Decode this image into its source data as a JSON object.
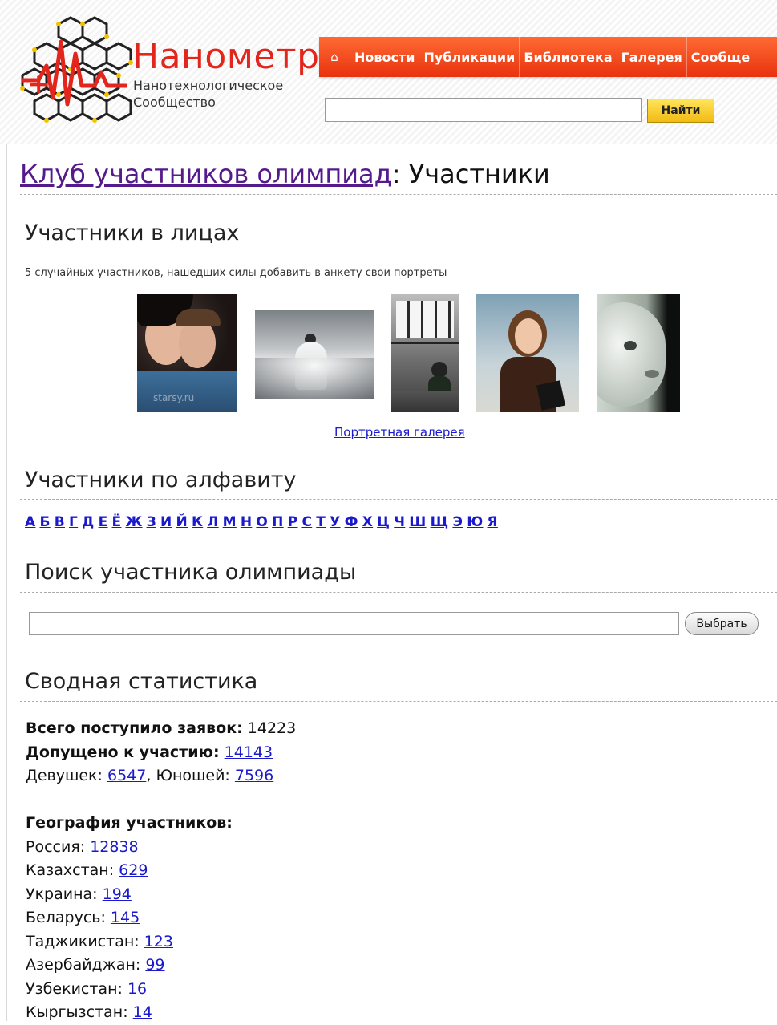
{
  "header": {
    "brand": "Нанометр",
    "tagline_line1": "Нанотехнологическое",
    "tagline_line2": "Сообщество",
    "nav": [
      "Новости",
      "Публикации",
      "Библиотека",
      "Галерея",
      "Сообще"
    ],
    "search_button": "Найти",
    "search_value": ""
  },
  "page": {
    "title_link": "Клуб участников олимпиад",
    "title_rest": ": Участники"
  },
  "faces": {
    "heading": "Участники в лицах",
    "note": "5 случайных участников, нашедших силы добавить в анкету свои портреты",
    "gallery_link": "Портретная галерея",
    "photo_watermark": "starsy.ru"
  },
  "alphabet": {
    "heading": "Участники по алфавиту",
    "letters": [
      "А",
      "Б",
      "В",
      "Г",
      "Д",
      "Е",
      "Ё",
      "Ж",
      "З",
      "И",
      "Й",
      "К",
      "Л",
      "М",
      "Н",
      "О",
      "П",
      "Р",
      "С",
      "Т",
      "У",
      "Ф",
      "Х",
      "Ц",
      "Ч",
      "Ш",
      "Щ",
      "Э",
      "Ю",
      "Я"
    ]
  },
  "search": {
    "heading": "Поиск участника олимпиады",
    "button": "Выбрать",
    "value": ""
  },
  "stats": {
    "heading": "Сводная статистика",
    "total_label": "Всего поступило заявок:",
    "total_value": "14223",
    "admitted_label": "Допущено к участию:",
    "admitted_value": "14143",
    "girls_label": "Девушек:",
    "girls_value": "6547",
    "boys_label": "Юношей:",
    "boys_value": "7596",
    "geo_heading": "География участников:",
    "countries": [
      {
        "name": "Россия:",
        "value": "12838"
      },
      {
        "name": "Казахстан:",
        "value": "629"
      },
      {
        "name": "Украина:",
        "value": "194"
      },
      {
        "name": "Беларусь:",
        "value": "145"
      },
      {
        "name": "Таджикистан:",
        "value": "123"
      },
      {
        "name": "Азербайджан:",
        "value": "99"
      },
      {
        "name": "Узбекистан:",
        "value": "16"
      },
      {
        "name": "Кыргызстан:",
        "value": "14"
      }
    ]
  },
  "colors": {
    "brand_red": "#e2261d",
    "nav_orange": "#f04a1c",
    "link_blue": "#1a1acc",
    "visited_purple": "#551a8b",
    "button_yellow": "#f7cf2f"
  }
}
